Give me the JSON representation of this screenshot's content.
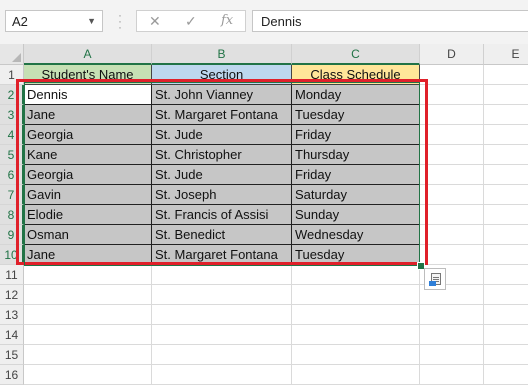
{
  "name_box": {
    "value": "A2"
  },
  "formula_bar": {
    "value": "Dennis",
    "fx_label": "fx",
    "cancel_symbol": "✕",
    "enter_symbol": "✓"
  },
  "columns": [
    "A",
    "B",
    "C",
    "D",
    "E"
  ],
  "rows": [
    "1",
    "2",
    "3",
    "4",
    "5",
    "6",
    "7",
    "8",
    "9",
    "10",
    "11",
    "12",
    "13",
    "14",
    "15",
    "16"
  ],
  "header_row": [
    "Student's Name",
    "Section",
    "Class Schedule"
  ],
  "header_colors": [
    "#c6e0b4",
    "#bdd7ee",
    "#ffe699"
  ],
  "data_rows": [
    [
      "Dennis",
      "St. John Vianney",
      "Monday"
    ],
    [
      "Jane",
      "St. Margaret Fontana",
      "Tuesday"
    ],
    [
      "Georgia",
      "St. Jude",
      "Friday"
    ],
    [
      "Kane",
      "St. Christopher",
      "Thursday"
    ],
    [
      "Georgia",
      "St. Jude",
      "Friday"
    ],
    [
      "Gavin",
      "St. Joseph",
      "Saturday"
    ],
    [
      "Elodie",
      "St. Francis of Assisi",
      "Sunday"
    ],
    [
      "Osman",
      "St. Benedict",
      "Wednesday"
    ],
    [
      "Jane",
      "St. Margaret Fontana",
      "Tuesday"
    ]
  ],
  "accent_colors": {
    "selection": "#217346",
    "highlight_box": "#e0202a"
  }
}
